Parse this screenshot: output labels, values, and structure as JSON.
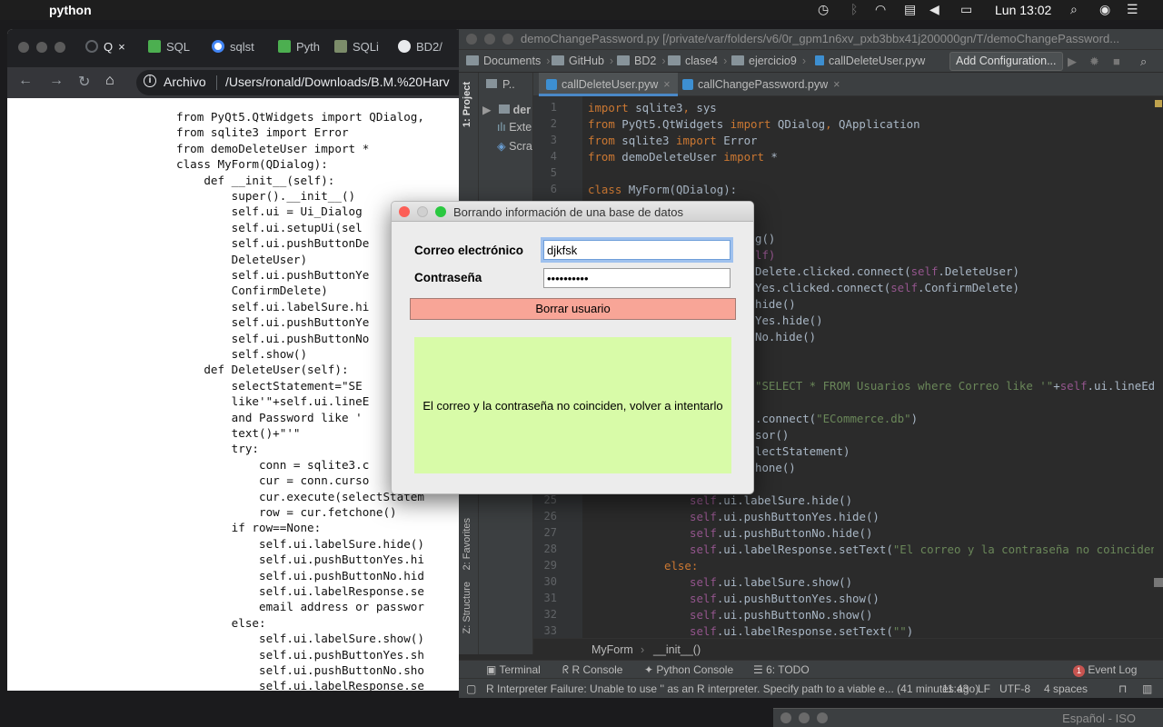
{
  "menubar": {
    "app_name": "python",
    "clock": "Lun 13:02"
  },
  "chrome": {
    "tabs": [
      {
        "label": "Q",
        "active": true
      },
      {
        "label": "SQL"
      },
      {
        "label": "sqlst"
      },
      {
        "label": "Pyth"
      },
      {
        "label": "SQLi"
      },
      {
        "label": "BD2/"
      }
    ],
    "address_label": "Archivo",
    "address_url": "/Users/ronald/Downloads/B.M.%20Harv",
    "code_lines": [
      "from PyQt5.QtWidgets import QDialog,",
      "from sqlite3 import Error",
      "from demoDeleteUser import *",
      "class MyForm(QDialog):",
      "    def __init__(self):",
      "        super().__init__()",
      "        self.ui = Ui_Dialog",
      "        self.ui.setupUi(sel",
      "        self.ui.pushButtonDe",
      "        DeleteUser)",
      "        self.ui.pushButtonYe",
      "        ConfirmDelete)",
      "        self.ui.labelSure.hi",
      "        self.ui.pushButtonYe",
      "        self.ui.pushButtonNo",
      "        self.show()",
      "    def DeleteUser(self):",
      "        selectStatement=\"SE",
      "        like'\"+self.ui.lineE",
      "        and Password like '",
      "        text()+\"'\"",
      "        try:",
      "            conn = sqlite3.c",
      "            cur = conn.curso",
      "            cur.execute(selectStatem",
      "            row = cur.fetchone()",
      "        if row==None:",
      "            self.ui.labelSure.hide()",
      "            self.ui.pushButtonYes.hi",
      "            self.ui.pushButtonNo.hid",
      "            self.ui.labelResponse.se",
      "            email address or passwor",
      "        else:",
      "            self.ui.labelSure.show()",
      "            self.ui.pushButtonYes.sh",
      "            self.ui.pushButtonNo.sho",
      "            self.ui.labelResponse.se"
    ]
  },
  "pycharm": {
    "title": "demoChangePassword.py [/private/var/folders/v6/0r_gpm1n6xv_pxb3bbx41j200000gn/T/demoChangePassword...",
    "breadcrumbs": [
      "Documents",
      "GitHub",
      "BD2",
      "clase4",
      "ejercicio9"
    ],
    "breadcrumb_file": "callDeleteUser.pyw",
    "add_configuration": "Add Configuration...",
    "side_labels": {
      "project": "1: Project",
      "favorites": "2: Favorites",
      "structure": "Z: Structure"
    },
    "project_header": "P..",
    "project_rows": [
      "der",
      "Exte",
      "Scra"
    ],
    "tabs": [
      {
        "label": "callDeleteUser.pyw",
        "active": true
      },
      {
        "label": "callChangePassword.pyw"
      }
    ],
    "line_numbers": [
      "1",
      "2",
      "3",
      "4",
      "5",
      "6",
      "",
      "",
      "",
      "",
      "",
      "",
      "",
      "",
      "",
      "",
      "",
      "",
      "",
      "",
      "",
      "",
      "",
      "",
      "25",
      "26",
      "27",
      "28",
      "29",
      "30",
      "31",
      "32",
      "33"
    ],
    "code": {
      "l1": [
        "import",
        " sqlite3",
        ",",
        " sys"
      ],
      "l2": [
        "from",
        " PyQt5.QtWidgets ",
        "import",
        " QDialog",
        ",",
        " QApplication"
      ],
      "l3": [
        "from",
        " sqlite3 ",
        "import",
        " Error"
      ],
      "l4": [
        "from",
        " demoDeleteUser ",
        "import",
        " *"
      ],
      "l6": [
        "class",
        " MyForm(QDialog):"
      ],
      "l9": "g()",
      "l10": "lf)",
      "l11a": "Delete.clicked.connect(",
      "l11b": "self",
      "l11c": ".DeleteUser)",
      "l12a": "Yes.clicked.connect(",
      "l12b": "self",
      "l12c": ".ConfirmDelete)",
      "l13": "hide()",
      "l14": "Yes.hide()",
      "l15": "No.hide()",
      "l18a": "\"SELECT * FROM Usuarios where Correo like '\"",
      "l18b": "+",
      "l18c": "self",
      "l18d": ".ui.lineEditEmai",
      "l20a": ".connect(",
      "l20b": "\"ECommerce.db\"",
      "l20c": ")",
      "l21": "sor()",
      "l22": "lectStatement)",
      "l23": "hone()",
      "l25": ".ui.labelSure.hide()",
      "l26": ".ui.pushButtonYes.hide()",
      "l27": ".ui.pushButtonNo.hide()",
      "l28a": ".ui.labelResponse.setText(",
      "l28b": "\"El correo y la contraseña no coinciden, volv",
      "l29": "else:",
      "l30": ".ui.labelSure.show()",
      "l31": ".ui.pushButtonYes.show()",
      "l32": ".ui.pushButtonNo.show()",
      "l33a": ".ui.labelResponse.setText(",
      "l33b": "\"\"",
      "l33c": ")",
      "self_kw": "self"
    },
    "crumbbar": [
      "MyForm",
      "__init__()"
    ],
    "toolwindows": [
      "Terminal",
      "R Console",
      "Python Console",
      "6: TODO"
    ],
    "event_log": "Event Log",
    "event_count": "1",
    "status": {
      "message": "R Interpreter Failure: Unable to use '' as an R interpreter. Specify path to a viable e... (41 minutes ago)",
      "position": "11:43",
      "line_sep": "LF",
      "encoding": "UTF-8",
      "indent": "4 spaces"
    }
  },
  "bottom_window": {
    "title": "Español - ISO"
  },
  "dialog": {
    "title": "Borrando información de una base de datos",
    "email_label": "Correo electrónico",
    "email_value": "djkfsk",
    "password_label": "Contraseña",
    "password_value": "••••••••••",
    "delete_button": "Borrar usuario",
    "response": "El correo y la contraseña no coinciden, volver a intentarlo",
    "colors": {
      "button": "#f8a597",
      "response_bg": "#d8fba8",
      "close": "#fc5f57",
      "zoom": "#2ac840"
    }
  }
}
